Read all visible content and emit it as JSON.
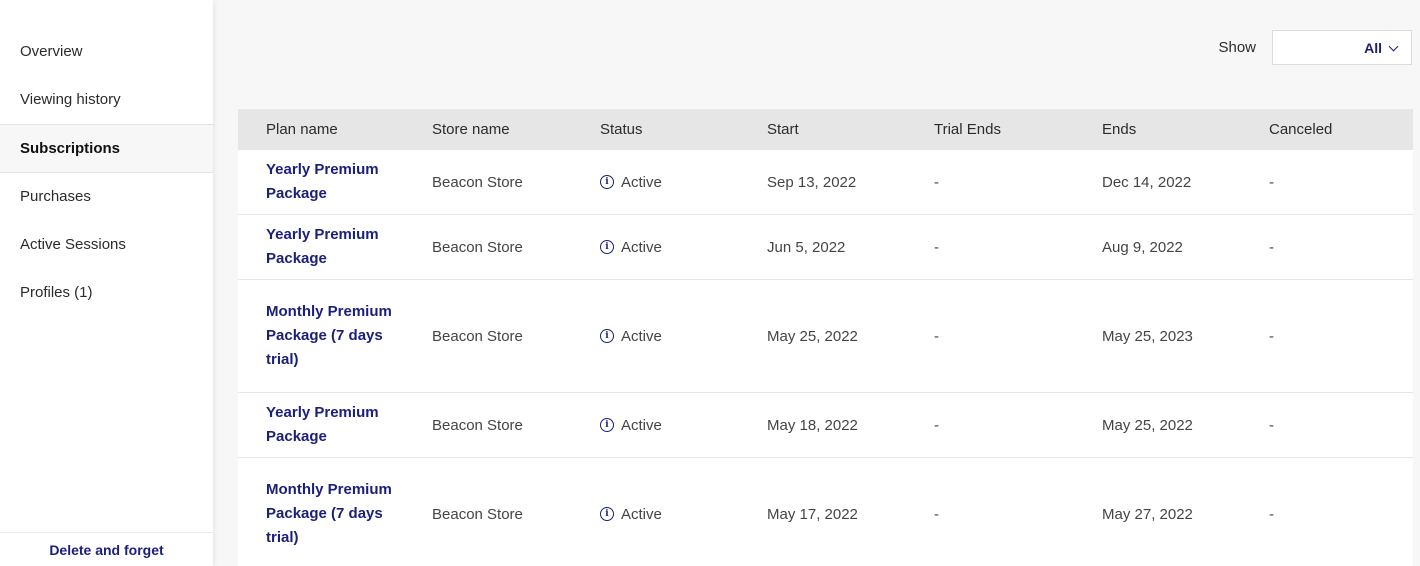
{
  "sidebar": {
    "items": [
      {
        "label": "Overview"
      },
      {
        "label": "Viewing history"
      },
      {
        "label": "Subscriptions"
      },
      {
        "label": "Purchases"
      },
      {
        "label": "Active Sessions"
      },
      {
        "label": "Profiles (1)"
      }
    ],
    "active_index": 2,
    "footer_link": "Delete and forget"
  },
  "filter": {
    "label": "Show",
    "value": "All"
  },
  "table": {
    "columns": [
      "Plan name",
      "Store name",
      "Status",
      "Start",
      "Trial Ends",
      "Ends",
      "Canceled"
    ],
    "rows": [
      {
        "plan": "Yearly Premium Package",
        "store": "Beacon Store",
        "status": "Active",
        "start": "Sep 13, 2022",
        "trial_ends": "-",
        "ends": "Dec 14, 2022",
        "canceled": "-"
      },
      {
        "plan": "Yearly Premium Package",
        "store": "Beacon Store",
        "status": "Active",
        "start": "Jun 5, 2022",
        "trial_ends": "-",
        "ends": "Aug 9, 2022",
        "canceled": "-"
      },
      {
        "plan": "Monthly Premium Package (7 days trial)",
        "store": "Beacon Store",
        "status": "Active",
        "start": "May 25, 2022",
        "trial_ends": "-",
        "ends": "May 25, 2023",
        "canceled": "-"
      },
      {
        "plan": "Yearly Premium Package",
        "store": "Beacon Store",
        "status": "Active",
        "start": "May 18, 2022",
        "trial_ends": "-",
        "ends": "May 25, 2022",
        "canceled": "-"
      },
      {
        "plan": "Monthly Premium Package (7 days trial)",
        "store": "Beacon Store",
        "status": "Active",
        "start": "May 17, 2022",
        "trial_ends": "-",
        "ends": "May 27, 2022",
        "canceled": "-"
      }
    ]
  },
  "colors": {
    "accent": "#1a1f7a",
    "header_bg": "#e6e6e6",
    "page_bg": "#f7f7f7"
  }
}
